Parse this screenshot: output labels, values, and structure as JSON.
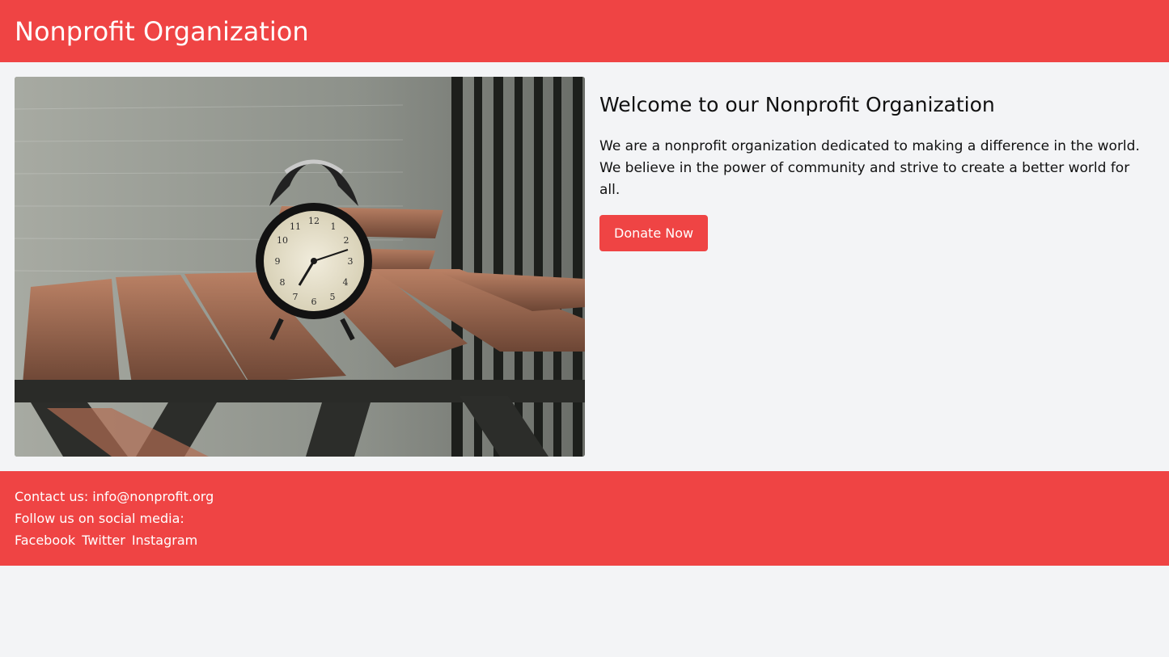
{
  "header": {
    "title": "Nonprofit Organization"
  },
  "hero": {
    "image_subject": "alarm clock on wooden bench"
  },
  "content": {
    "title": "Welcome to our Nonprofit Organization",
    "body": "We are a nonprofit organization dedicated to making a difference in the world. We believe in the power of community and strive to create a better world for all.",
    "donate_label": "Donate Now"
  },
  "footer": {
    "contact": "Contact us: info@nonprofit.org",
    "social_heading": "Follow us on social media:",
    "social_links": [
      "Facebook",
      "Twitter",
      "Instagram"
    ]
  },
  "colors": {
    "brand": "#ef4444",
    "background": "#f3f4f6"
  }
}
